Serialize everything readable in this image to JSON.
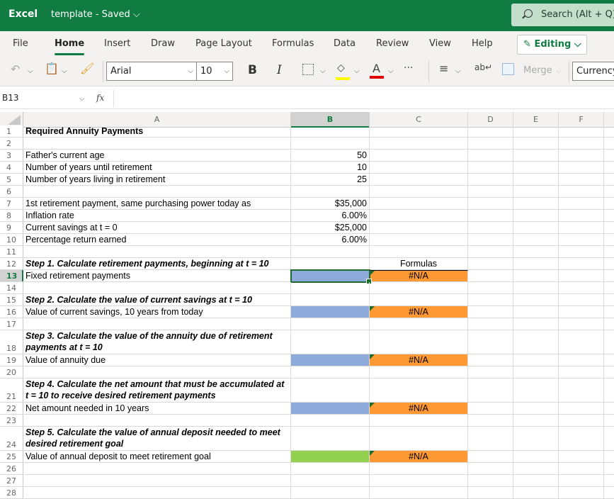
{
  "titlebar": {
    "app": "Excel",
    "doc_title": "template - Saved ⌵",
    "search_placeholder": "Search (Alt + Q)"
  },
  "menu": {
    "tabs": [
      "File",
      "Home",
      "Insert",
      "Draw",
      "Page Layout",
      "Formulas",
      "Data",
      "Review",
      "View",
      "Help"
    ],
    "active": "Home",
    "editing_label": "Editing ⌵"
  },
  "ribbon": {
    "font": "Arial",
    "size": "10",
    "bold": "B",
    "italic": "I",
    "more": "···",
    "merge": "Merge",
    "number_format": "Currency",
    "colors": {
      "highlight": "#ffff00",
      "font_color": "#e00000"
    }
  },
  "formula_bar": {
    "name_box": "B13",
    "fx": "fx",
    "formula": ""
  },
  "columns": [
    "A",
    "B",
    "C",
    "D",
    "E",
    "F"
  ],
  "selected_cell": "B13",
  "rows": [
    {
      "n": "1",
      "a": "Required Annuity Payments",
      "a_style": "bold"
    },
    {
      "n": "2"
    },
    {
      "n": "3",
      "a": "Father's current age",
      "b": "50"
    },
    {
      "n": "4",
      "a": "Number of years until retirement",
      "b": "10"
    },
    {
      "n": "5",
      "a": "Number of years living in retirement",
      "b": "25"
    },
    {
      "n": "6"
    },
    {
      "n": "7",
      "a": "1st retirement payment, same purchasing power today as",
      "b": "$35,000"
    },
    {
      "n": "8",
      "a": "Inflation rate",
      "b": "6.00%"
    },
    {
      "n": "9",
      "a": "Current savings at t = 0",
      "b": "$25,000"
    },
    {
      "n": "10",
      "a": "Percentage return earned",
      "b": "6.00%"
    },
    {
      "n": "11"
    },
    {
      "n": "12",
      "a": "Step 1. Calculate retirement payments, beginning at t = 10",
      "a_style": "ital",
      "c": "Formulas"
    },
    {
      "n": "13",
      "a": "Fixed retirement payments",
      "b_fill": "blue",
      "c": "#N/A",
      "c_fill": "orange"
    },
    {
      "n": "14"
    },
    {
      "n": "15",
      "a": "Step 2. Calculate the value of current savings at t = 10",
      "a_style": "ital"
    },
    {
      "n": "16",
      "a": "Value of current savings, 10 years from today",
      "b_fill": "blue",
      "c": "#N/A",
      "c_fill": "orange"
    },
    {
      "n": "17"
    },
    {
      "n": "18",
      "a": "Step 3. Calculate the value of the annuity due of retirement payments at t = 10",
      "a_style": "ital",
      "tall": true
    },
    {
      "n": "19",
      "a": "Value of annuity due",
      "b_fill": "blue",
      "c": "#N/A",
      "c_fill": "orange"
    },
    {
      "n": "20"
    },
    {
      "n": "21",
      "a": "Step 4. Calculate the net amount that must be accumulated at t = 10 to receive desired retirement payments",
      "a_style": "ital",
      "tall": true
    },
    {
      "n": "22",
      "a": "Net amount needed in 10 years",
      "b_fill": "blue",
      "c": "#N/A",
      "c_fill": "orange"
    },
    {
      "n": "23"
    },
    {
      "n": "24",
      "a": "Step 5. Calculate the value of annual deposit needed to meet desired retirement goal",
      "a_style": "ital",
      "tall": true
    },
    {
      "n": "25",
      "a": "Value of annual deposit to meet retirement goal",
      "b_fill": "green",
      "c": "#N/A",
      "c_fill": "orange"
    },
    {
      "n": "26"
    },
    {
      "n": "27"
    },
    {
      "n": "28"
    }
  ],
  "fill_colors": {
    "blue": "#8eaadb",
    "green": "#92d050",
    "orange": "#ff9933",
    "accent": "#107c41"
  }
}
